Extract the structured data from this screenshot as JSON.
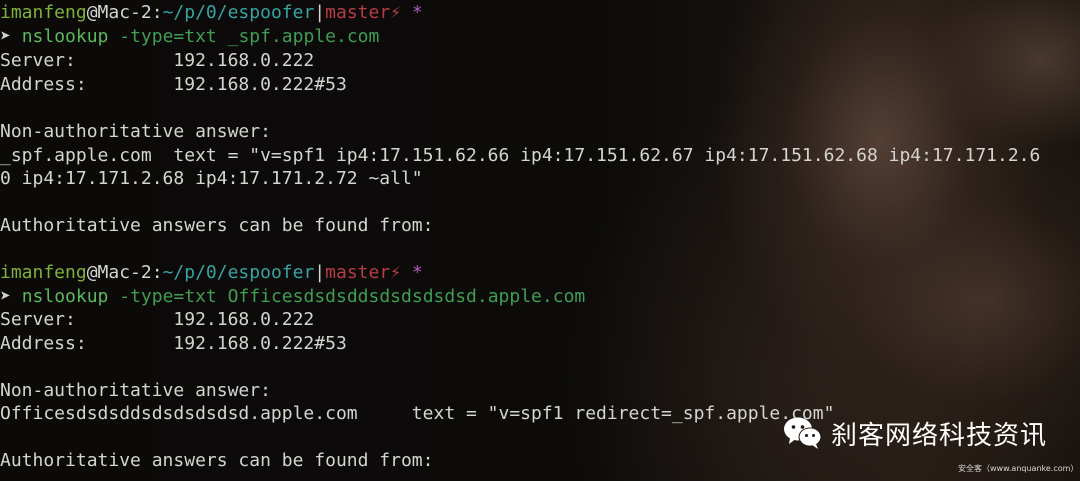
{
  "terminal": {
    "prompt1": {
      "user": "imanfeng",
      "at": "@",
      "host": "Mac-2",
      "colon": ":",
      "path": "~/p/0/espoofer",
      "sep": "|",
      "branch": "master",
      "bolt": "⚡",
      "dirty": " *"
    },
    "cmd1": {
      "arrow": "➤ ",
      "command": "nslookup",
      "option": "-type=txt",
      "argument": "_spf.apple.com"
    },
    "out1": [
      "Server:         192.168.0.222",
      "Address:        192.168.0.222#53",
      "",
      "Non-authoritative answer:",
      "_spf.apple.com  text = \"v=spf1 ip4:17.151.62.66 ip4:17.151.62.67 ip4:17.151.62.68 ip4:17.171.2.6",
      "0 ip4:17.171.2.68 ip4:17.171.2.72 ~all\"",
      "",
      "Authoritative answers can be found from:",
      ""
    ],
    "prompt2": {
      "user": "imanfeng",
      "at": "@",
      "host": "Mac-2",
      "colon": ":",
      "path": "~/p/0/espoofer",
      "sep": "|",
      "branch": "master",
      "bolt": "⚡",
      "dirty": " *"
    },
    "cmd2": {
      "arrow": "➤ ",
      "command": "nslookup",
      "option": "-type=txt",
      "argument": "Officesdsdsddsdsdsdsdsd.apple.com"
    },
    "out2": [
      "Server:         192.168.0.222",
      "Address:        192.168.0.222#53",
      "",
      "Non-authoritative answer:",
      "Officesdsdsddsdsdsdsdsd.apple.com     text = \"v=spf1 redirect=_spf.apple.com\"",
      "",
      "Authoritative answers can be found from:"
    ]
  },
  "watermark": {
    "title": "刹客网络科技资讯",
    "subtitle": "安全客（www.anquanke.com）",
    "icon": "wechat-icon"
  },
  "colors": {
    "user": "#7fb13d",
    "path": "#38a3a3",
    "branch": "#b83c46",
    "dirty": "#b05ac5",
    "command": "#5cb85c",
    "text": "#d4d4d0"
  }
}
